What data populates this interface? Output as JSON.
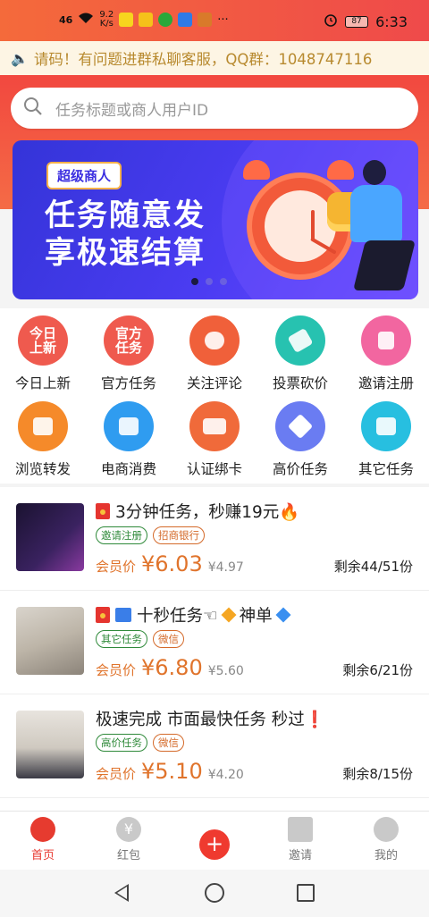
{
  "status_bar": {
    "signal": "46",
    "speed_value": "9.2",
    "speed_unit": "K/s",
    "battery": "87",
    "time": "6:33"
  },
  "notice": {
    "text": "请码！有问题进群私聊客服，QQ群：1048747116"
  },
  "search": {
    "placeholder": "任务标题或商人用户ID"
  },
  "banner": {
    "badge": "超级商人",
    "line1": "任务随意发",
    "line2": "享极速结算",
    "active_dot": 1,
    "dot_count": 3
  },
  "categories": [
    {
      "label": "今日上新",
      "icon_text": "今日\n上新",
      "icon": "today-new-icon",
      "color": "#ef5a4e"
    },
    {
      "label": "官方任务",
      "icon_text": "官方\n任务",
      "icon": "official-task-icon",
      "color": "#ef5a4e"
    },
    {
      "label": "关注评论",
      "icon_text": "",
      "icon": "comment-icon",
      "color": "#f0603a"
    },
    {
      "label": "投票砍价",
      "icon_text": "",
      "icon": "tag-icon",
      "color": "#27c2b0"
    },
    {
      "label": "邀请注册",
      "icon_text": "",
      "icon": "download-icon",
      "color": "#f266a0"
    },
    {
      "label": "浏览转发",
      "icon_text": "",
      "icon": "share-icon",
      "color": "#f58a2a"
    },
    {
      "label": "电商消费",
      "icon_text": "",
      "icon": "shop-icon",
      "color": "#2f9cf0"
    },
    {
      "label": "认证绑卡",
      "icon_text": "",
      "icon": "card-icon",
      "color": "#f06a3a"
    },
    {
      "label": "高价任务",
      "icon_text": "",
      "icon": "diamond-icon",
      "color": "#6a7cf2"
    },
    {
      "label": "其它任务",
      "icon_text": "",
      "icon": "check-icon",
      "color": "#27bfe0"
    }
  ],
  "tasks": [
    {
      "title": "3分钟任务，秒赚19元🔥",
      "tag1": "邀请注册",
      "tag2": "招商银行",
      "price_label": "会员价",
      "price": "¥6.03",
      "original": "¥4.97",
      "remain": "剩余44/51份"
    },
    {
      "title_a": "十秒任务☜",
      "title_b": "神单",
      "tag1": "其它任务",
      "tag2": "微信",
      "price_label": "会员价",
      "price": "¥6.80",
      "original": "¥5.60",
      "remain": "剩余6/21份"
    },
    {
      "title": "极速完成 市面最快任务 秒过❗",
      "tag1": "高价任务",
      "tag2": "微信",
      "price_label": "会员价",
      "price": "¥5.10",
      "original": "¥4.20",
      "remain": "剩余8/15份"
    }
  ],
  "tabbar": {
    "home": "首页",
    "redpack": "红包",
    "plus": "+",
    "invite": "邀请",
    "mine": "我的",
    "redpack_glyph": "¥"
  },
  "colors": {
    "brand": "#ef4a3f",
    "price": "#e0742c",
    "notice_text": "#b88a2f"
  }
}
